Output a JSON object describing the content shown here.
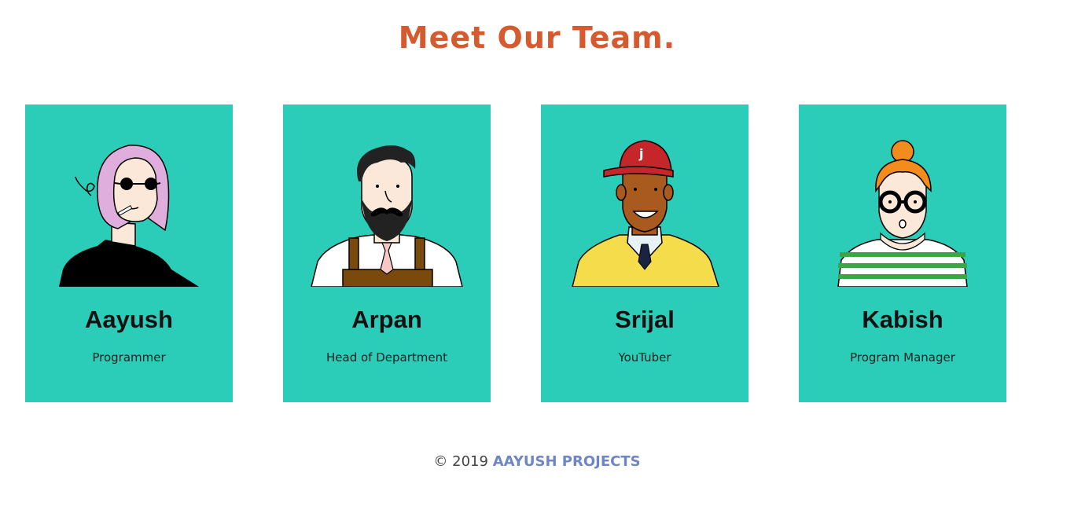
{
  "page": {
    "title": "Meet Our Team."
  },
  "team": [
    {
      "name": "Aayush",
      "role": "Programmer",
      "avatar": "smoking-sunglasses-avatar-icon"
    },
    {
      "name": "Arpan",
      "role": "Head of Department",
      "avatar": "bearded-apron-avatar-icon"
    },
    {
      "name": "Srijal",
      "role": "YouTuber",
      "avatar": "red-cap-avatar-icon"
    },
    {
      "name": "Kabish",
      "role": "Program Manager",
      "avatar": "glasses-bun-avatar-icon"
    }
  ],
  "footer": {
    "copyright": "© 2019",
    "brand": "AAYUSH PROJECTS"
  },
  "colors": {
    "accent": "#d65a30",
    "card": "#2bcdb9",
    "brand": "#6e87c4"
  }
}
